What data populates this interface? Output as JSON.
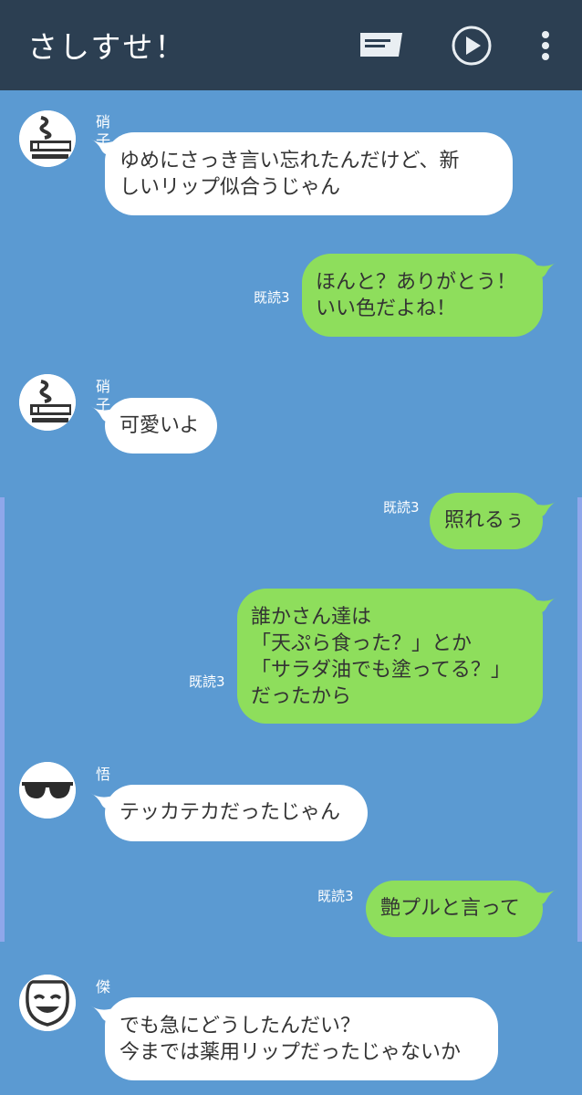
{
  "header": {
    "title": "さしすせ！",
    "icons": [
      "message-icon",
      "play-icon",
      "more-vertical-icon"
    ]
  },
  "colors": {
    "background": "#5b9ad2",
    "header": "#2c3f52",
    "bubble_incoming": "#ffffff",
    "bubble_outgoing": "#8ede5c"
  },
  "messages": [
    {
      "side": "left",
      "sender": "硝子",
      "avatar": "smoker-avatar",
      "lines": [
        "ゆめにさっき言い忘れたんだけど、新",
        "しいリップ似合うじゃん"
      ]
    },
    {
      "side": "right",
      "read": "既読3",
      "lines": [
        "ほんと？ありがとう！",
        "いい色だよね！"
      ]
    },
    {
      "side": "left",
      "sender": "硝子",
      "avatar": "smoker-avatar",
      "lines": [
        "可愛いよ"
      ]
    },
    {
      "side": "right",
      "read": "既読3",
      "lines": [
        "照れるぅ"
      ]
    },
    {
      "side": "right",
      "read": "既読3",
      "lines": [
        "誰かさん達は",
        "「天ぷら食った？」とか",
        "「サラダ油でも塗ってる？」",
        "だったから"
      ]
    },
    {
      "side": "left",
      "sender": "悟",
      "avatar": "sunglasses-avatar",
      "lines": [
        "テッカテカだったじゃん"
      ]
    },
    {
      "side": "right",
      "read": "既読3",
      "lines": [
        "艶プルと言って"
      ]
    },
    {
      "side": "left",
      "sender": "傑",
      "avatar": "smiling-mask-avatar",
      "lines": [
        "でも急にどうしたんだい？",
        "今までは薬用リップだったじゃないか"
      ]
    }
  ]
}
